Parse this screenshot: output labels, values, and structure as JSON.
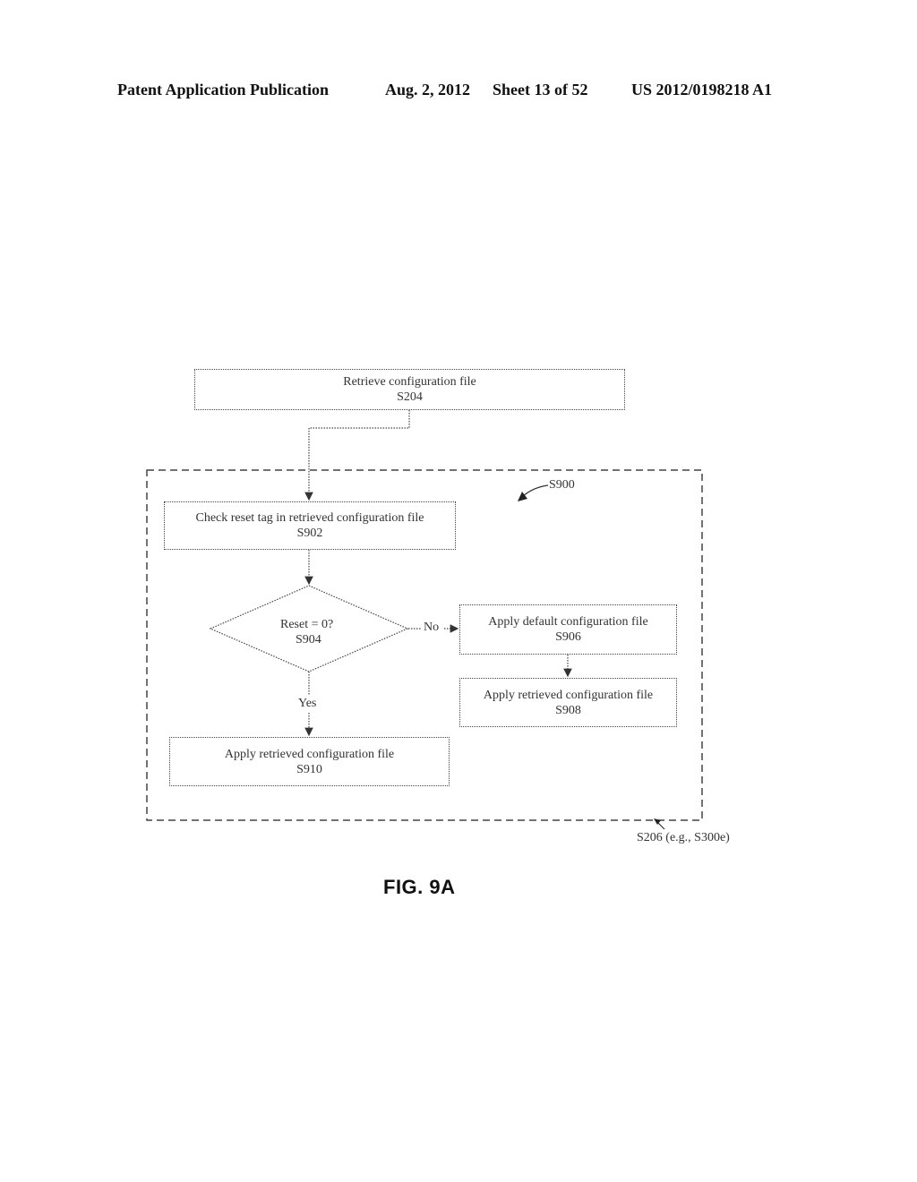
{
  "header": {
    "publication": "Patent Application Publication",
    "date": "Aug. 2, 2012",
    "sheet": "Sheet 13 of 52",
    "number": "US 2012/0198218 A1"
  },
  "diagram": {
    "nodes": {
      "s204": {
        "text": "Retrieve configuration file",
        "step": "S204"
      },
      "s902": {
        "text": "Check reset tag in retrieved configuration file",
        "step": "S902"
      },
      "s904": {
        "text": "Reset = 0?",
        "step": "S904"
      },
      "s906": {
        "text": "Apply default configuration file",
        "step": "S906"
      },
      "s908": {
        "text": "Apply retrieved configuration file",
        "step": "S908"
      },
      "s910": {
        "text": "Apply retrieved configuration file",
        "step": "S910"
      }
    },
    "edges": {
      "no_label": "No",
      "yes_label": "Yes"
    },
    "group_label": "S900",
    "outer_label": "S206 (e.g., S300e)"
  },
  "figure_caption": "FIG. 9A"
}
